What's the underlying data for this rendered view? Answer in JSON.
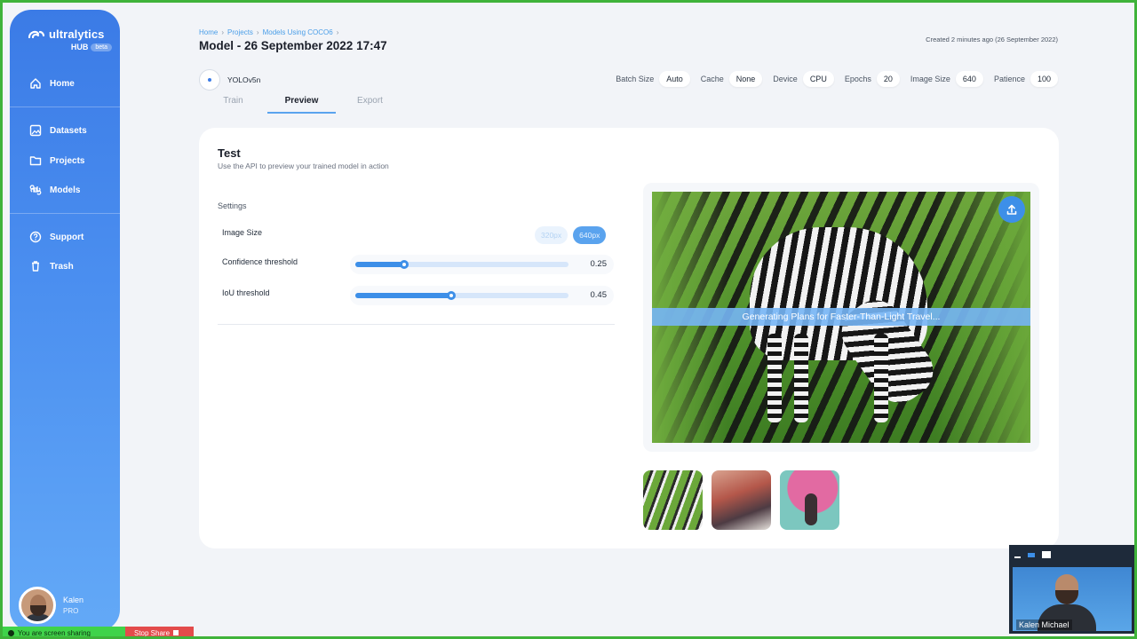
{
  "sidebar": {
    "brand": {
      "name": "ultralytics",
      "hub": "HUB",
      "badge": "beta"
    },
    "items": [
      {
        "label": "Home",
        "icon": "home-icon"
      },
      {
        "label": "Datasets",
        "icon": "image-icon"
      },
      {
        "label": "Projects",
        "icon": "folder-icon"
      },
      {
        "label": "Models",
        "icon": "command-icon"
      },
      {
        "label": "Support",
        "icon": "help-icon"
      },
      {
        "label": "Trash",
        "icon": "trash-icon"
      }
    ],
    "user": {
      "name": "Kalen",
      "plan": "PRO"
    }
  },
  "header": {
    "breadcrumb": [
      "Home",
      "Projects",
      "Models Using COCO6"
    ],
    "title": "Model - 26 September 2022 17:47",
    "created": "Created 2 minutes ago (26 September 2022)",
    "model_name": "YOLOv5n",
    "params": [
      {
        "label": "Batch Size",
        "value": "Auto"
      },
      {
        "label": "Cache",
        "value": "None"
      },
      {
        "label": "Device",
        "value": "CPU"
      },
      {
        "label": "Epochs",
        "value": "20"
      },
      {
        "label": "Image Size",
        "value": "640"
      },
      {
        "label": "Patience",
        "value": "100"
      }
    ],
    "tabs": [
      "Train",
      "Preview",
      "Export"
    ],
    "active_tab": "Preview"
  },
  "test": {
    "title": "Test",
    "subtitle": "Use the API to preview your trained model in action",
    "settings_label": "Settings",
    "image_size_label": "Image Size",
    "size_options": [
      "320px",
      "640px"
    ],
    "selected_size": "640px",
    "confidence_label": "Confidence threshold",
    "confidence_value": "0.25",
    "confidence_fraction": 0.23,
    "iou_label": "IoU threshold",
    "iou_value": "0.45",
    "iou_fraction": 0.45,
    "overlay_text": "Generating Plans for Faster-Than-Light Travel...",
    "thumbnails": [
      "zebra",
      "room",
      "umbrella"
    ]
  },
  "share_bar": {
    "status": "You are screen sharing",
    "stop": "Stop Share"
  },
  "webcam": {
    "name": "Kalen Michael"
  },
  "colors": {
    "accent": "#3d8fe8",
    "sidebar": "#3b7be6",
    "share": "#3fd34a",
    "stop": "#e34b4b"
  }
}
